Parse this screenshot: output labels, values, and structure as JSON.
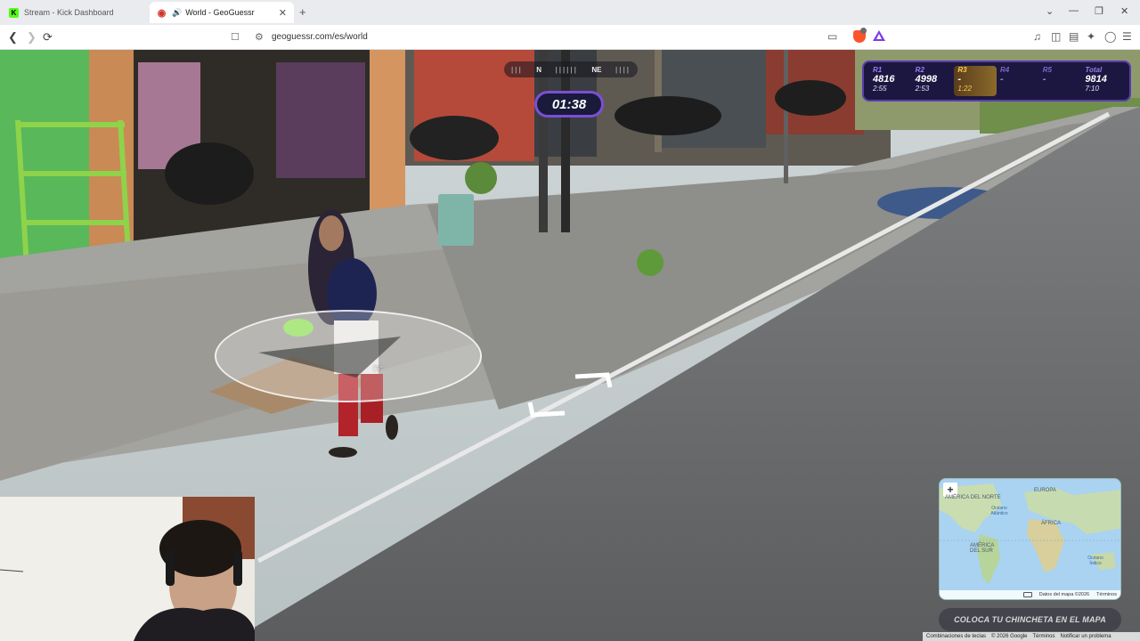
{
  "tabs": [
    {
      "title": "Stream - Kick Dashboard",
      "favicon": "kick-icon",
      "active": false
    },
    {
      "title": "World - GeoGuessr",
      "favicon": "geoguessr-pin-icon",
      "active": true
    }
  ],
  "address_bar": {
    "url": "geoguessr.com/es/world"
  },
  "game": {
    "compass": {
      "left": "N",
      "right": "NE"
    },
    "timer": "01:38",
    "rounds": [
      {
        "label": "R1",
        "score": "4816",
        "time": "2:55"
      },
      {
        "label": "R2",
        "score": "4998",
        "time": "2:53"
      },
      {
        "label": "R3",
        "score": "-",
        "time": "1:22"
      },
      {
        "label": "R4",
        "score": "-",
        "time": ""
      },
      {
        "label": "R5",
        "score": "-",
        "time": ""
      },
      {
        "label": "Total",
        "score": "9814",
        "time": "7:10"
      }
    ],
    "guess_button": "COLOCA TU CHINCHETA EN EL MAPA"
  },
  "minimap": {
    "labels": {
      "north_america": "AMÉRICA DEL NORTE",
      "europe": "EUROPA",
      "atlantic": "Océano Atlántico",
      "africa": "ÁFRICA",
      "south_america": "AMÉRICA DEL SUR",
      "indian": "Océano Índico"
    },
    "footer": {
      "data": "Datos del mapa ©2026",
      "terms": "Términos"
    }
  },
  "google_footer": {
    "shortcuts": "Combinaciones de teclas",
    "copyright": "© 2026 Google",
    "terms": "Términos",
    "report": "Notificar un problema"
  },
  "colors": {
    "accent": "#7b4fd6",
    "panel": "#1c1740",
    "current_round": "#ffcc55"
  }
}
